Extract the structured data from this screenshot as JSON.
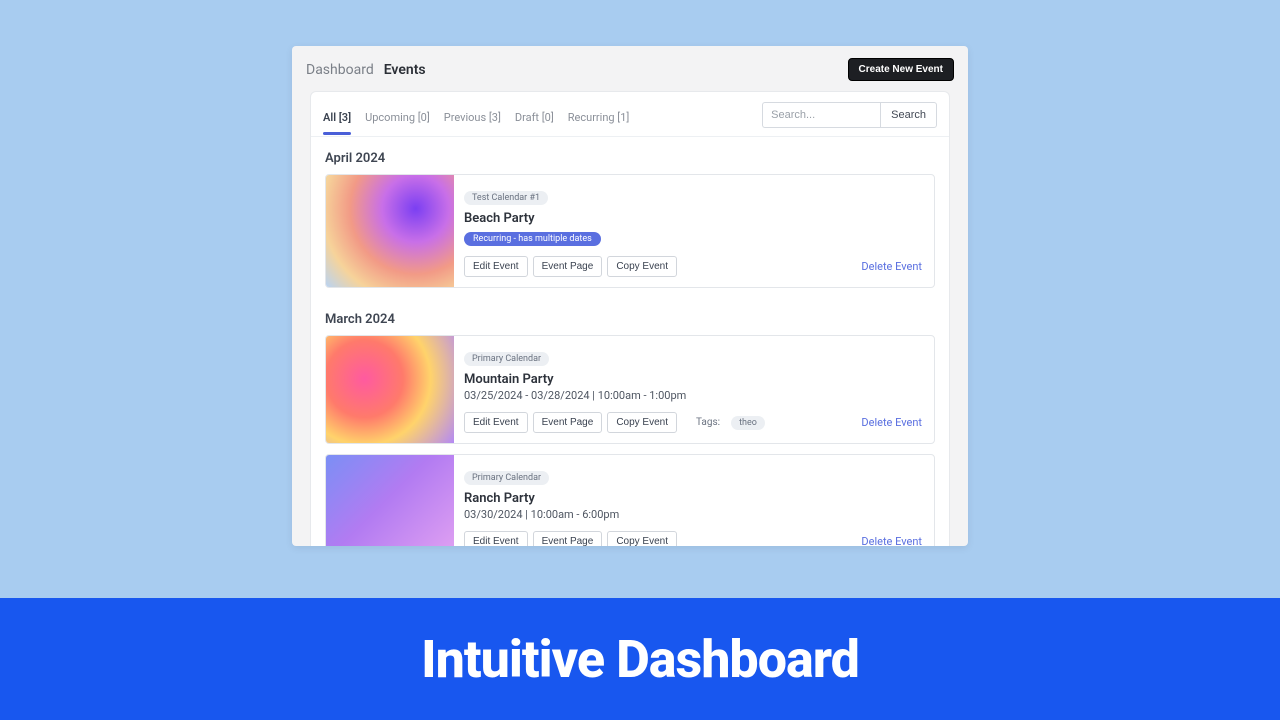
{
  "breadcrumb": {
    "parent": "Dashboard",
    "current": "Events"
  },
  "create_button": "Create New Event",
  "tabs": [
    {
      "label": "All [3]",
      "active": true
    },
    {
      "label": "Upcoming [0]",
      "active": false
    },
    {
      "label": "Previous [3]",
      "active": false
    },
    {
      "label": "Draft [0]",
      "active": false
    },
    {
      "label": "Recurring [1]",
      "active": false
    }
  ],
  "search": {
    "placeholder": "Search...",
    "button": "Search"
  },
  "months": [
    {
      "heading": "April 2024",
      "events": [
        {
          "calendar": "Test Calendar #1",
          "title": "Beach Party",
          "recurring": "Recurring - has multiple dates",
          "thumb": "g1",
          "buttons": [
            "Edit Event",
            "Event Page",
            "Copy Event"
          ],
          "delete": "Delete Event"
        }
      ]
    },
    {
      "heading": "March 2024",
      "events": [
        {
          "calendar": "Primary Calendar",
          "title": "Mountain Party",
          "sub": "03/25/2024 - 03/28/2024 | 10:00am - 1:00pm",
          "thumb": "g2",
          "buttons": [
            "Edit Event",
            "Event Page",
            "Copy Event"
          ],
          "tags_label": "Tags:",
          "tags": [
            "theo"
          ],
          "delete": "Delete Event"
        },
        {
          "calendar": "Primary Calendar",
          "title": "Ranch Party",
          "sub": "03/30/2024 | 10:00am - 6:00pm",
          "thumb": "g3",
          "buttons": [
            "Edit Event",
            "Event Page",
            "Copy Event"
          ],
          "delete": "Delete Event"
        }
      ]
    }
  ],
  "banner": "Intuitive Dashboard"
}
